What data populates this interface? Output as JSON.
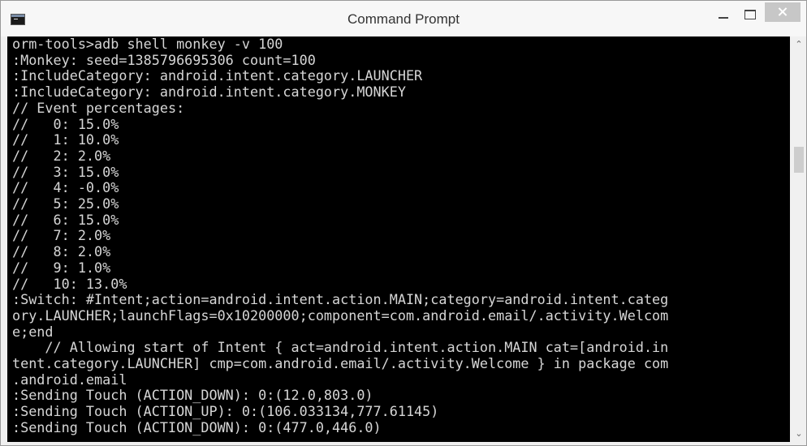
{
  "window": {
    "title": "Command Prompt"
  },
  "console": {
    "lines": [
      "orm-tools>adb shell monkey -v 100",
      ":Monkey: seed=1385796695306 count=100",
      ":IncludeCategory: android.intent.category.LAUNCHER",
      ":IncludeCategory: android.intent.category.MONKEY",
      "// Event percentages:",
      "//   0: 15.0%",
      "//   1: 10.0%",
      "//   2: 2.0%",
      "//   3: 15.0%",
      "//   4: -0.0%",
      "//   5: 25.0%",
      "//   6: 15.0%",
      "//   7: 2.0%",
      "//   8: 2.0%",
      "//   9: 1.0%",
      "//   10: 13.0%",
      ":Switch: #Intent;action=android.intent.action.MAIN;category=android.intent.categ",
      "ory.LAUNCHER;launchFlags=0x10200000;component=com.android.email/.activity.Welcom",
      "e;end",
      "    // Allowing start of Intent { act=android.intent.action.MAIN cat=[android.in",
      "tent.category.LAUNCHER] cmp=com.android.email/.activity.Welcome } in package com",
      ".android.email",
      ":Sending Touch (ACTION_DOWN): 0:(12.0,803.0)",
      ":Sending Touch (ACTION_UP): 0:(106.033134,777.61145)",
      ":Sending Touch (ACTION_DOWN): 0:(477.0,446.0)"
    ]
  },
  "colors": {
    "console_bg": "#000000",
    "console_text": "#d6d6d6",
    "titlebar_bg": "#f7f7f7",
    "close_button": "#c7c7c7"
  },
  "icons": {
    "app": "cmd-window-icon",
    "minimize": "minimize-icon",
    "maximize": "maximize-icon",
    "close": "close-icon",
    "scroll_up": "chevron-up-icon",
    "scroll_down": "chevron-down-icon"
  }
}
